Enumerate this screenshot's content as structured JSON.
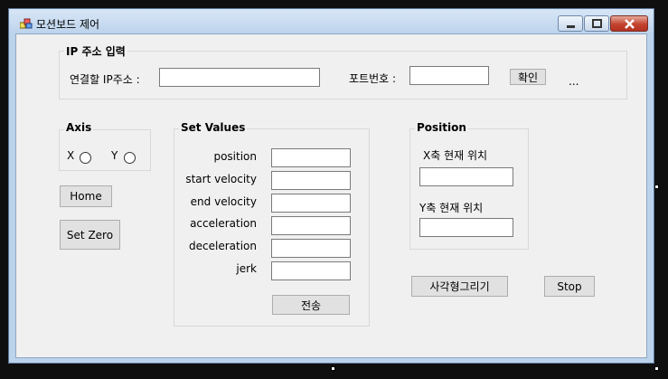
{
  "window": {
    "title": "모션보드 제어"
  },
  "ip_group": {
    "title": "IP 주소 입력",
    "ip_label": "연결할 IP주소 :",
    "ip_value": "",
    "port_label": "포트번호 :",
    "port_value": "",
    "confirm_label": "확인",
    "ellipsis": "..."
  },
  "axis_group": {
    "title": "Axis",
    "x_label": "X",
    "y_label": "Y"
  },
  "buttons": {
    "home": "Home",
    "set_zero": "Set Zero",
    "send": "전송",
    "draw_rect": "사각형그리기",
    "stop": "Stop"
  },
  "set_values": {
    "title": "Set Values",
    "fields": [
      {
        "label": "position",
        "value": ""
      },
      {
        "label": "start velocity",
        "value": ""
      },
      {
        "label": "end velocity",
        "value": ""
      },
      {
        "label": "acceleration",
        "value": ""
      },
      {
        "label": "deceleration",
        "value": ""
      },
      {
        "label": "jerk",
        "value": ""
      }
    ]
  },
  "position_group": {
    "title": "Position",
    "x_label": "X축 현재 위치",
    "x_value": "",
    "y_label": "Y축 현재 위치",
    "y_value": ""
  }
}
